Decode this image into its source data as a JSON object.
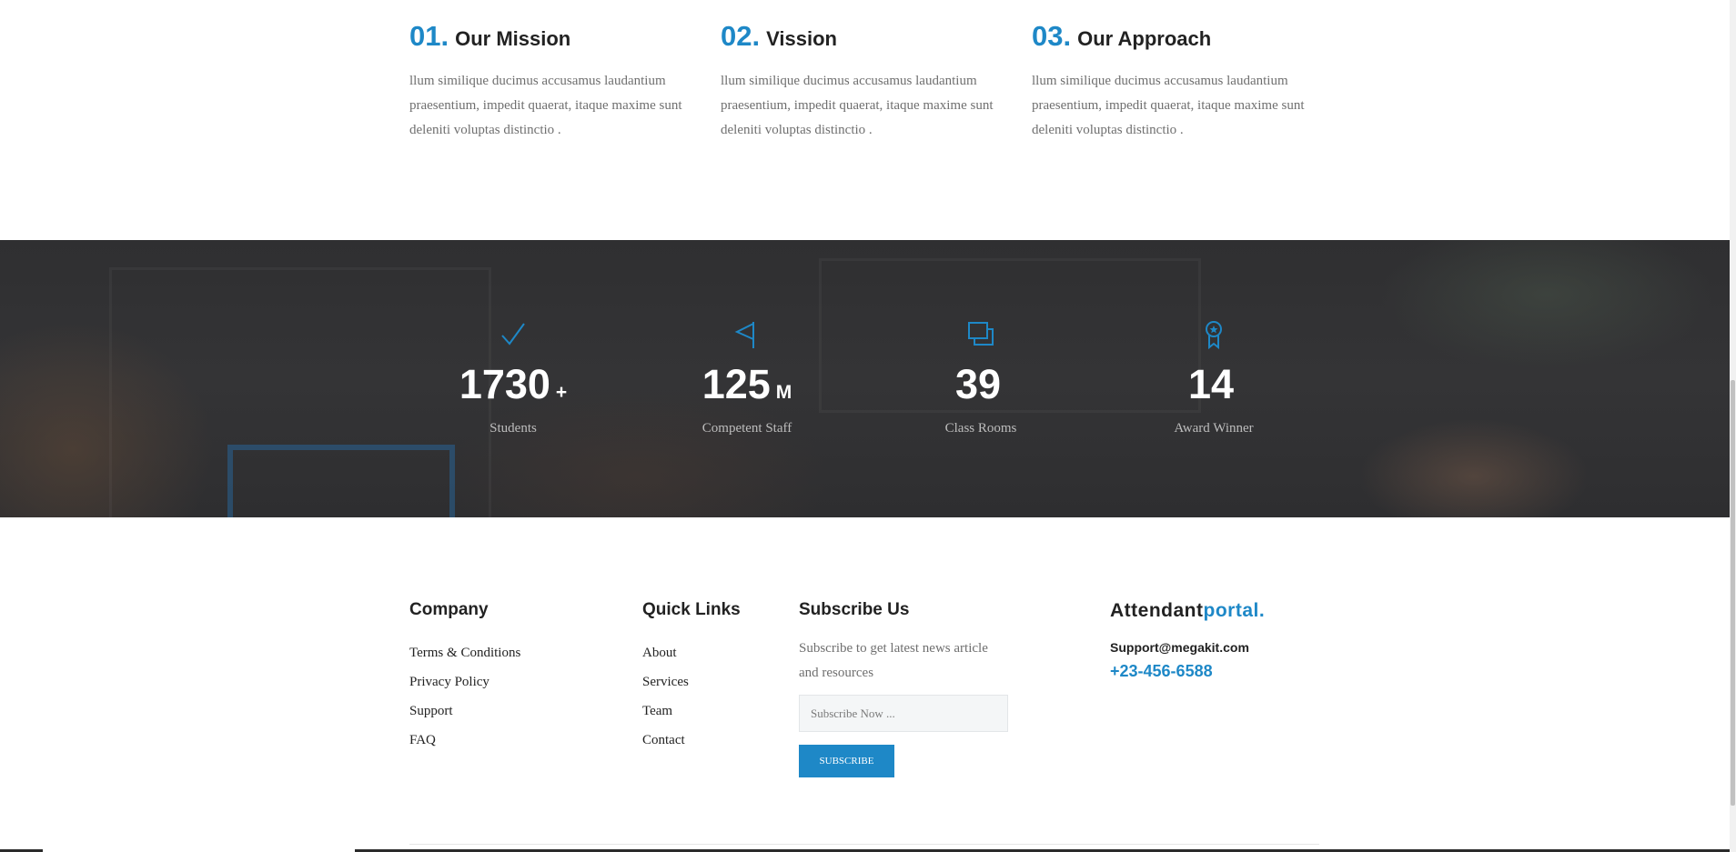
{
  "features": [
    {
      "num": "01.",
      "title": "Our Mission",
      "text": "llum similique ducimus accusamus laudantium praesentium, impedit quaerat, itaque maxime sunt deleniti voluptas distinctio ."
    },
    {
      "num": "02.",
      "title": "Vission",
      "text": "llum similique ducimus accusamus laudantium praesentium, impedit quaerat, itaque maxime sunt deleniti voluptas distinctio ."
    },
    {
      "num": "03.",
      "title": "Our Approach",
      "text": "llum similique ducimus accusamus laudantium praesentium, impedit quaerat, itaque maxime sunt deleniti voluptas distinctio ."
    }
  ],
  "stats": [
    {
      "icon": "checkmark-icon",
      "value": "1730",
      "suffix": "+",
      "label": "Students"
    },
    {
      "icon": "flag-icon",
      "value": "125",
      "suffix": "M",
      "label": "Competent Staff"
    },
    {
      "icon": "layers-icon",
      "value": "39",
      "suffix": "",
      "label": "Class Rooms"
    },
    {
      "icon": "award-icon",
      "value": "14",
      "suffix": "",
      "label": "Award Winner"
    }
  ],
  "footer": {
    "company": {
      "heading": "Company",
      "links": [
        "Terms & Conditions",
        "Privacy Policy",
        "Support",
        "FAQ"
      ]
    },
    "quick_links": {
      "heading": "Quick Links",
      "links": [
        "About",
        "Services",
        "Team",
        "Contact"
      ]
    },
    "subscribe": {
      "heading": "Subscribe Us",
      "text": "Subscribe to get latest news article and resources",
      "placeholder": "Subscribe Now ...",
      "button": "Subscribe"
    },
    "brand": {
      "name_main": "Attendant",
      "name_accent": "portal.",
      "email": "Support@megakit.com",
      "phone": "+23-456-6588"
    }
  },
  "colors": {
    "accent": "#1e88c7",
    "heading": "#222222",
    "body_text": "#6f6f6f",
    "stats_background": "#333335"
  }
}
